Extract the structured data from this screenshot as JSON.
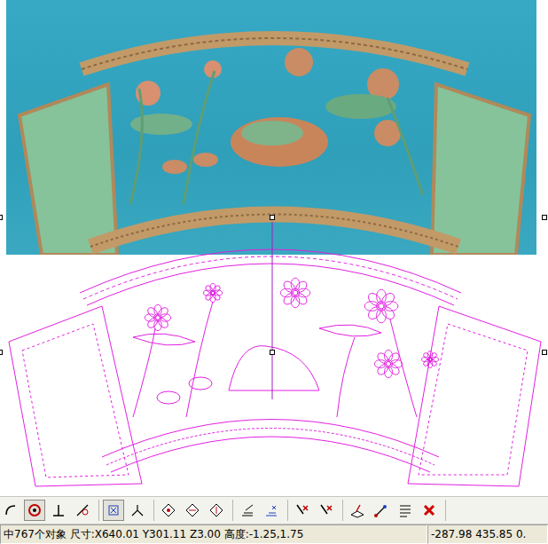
{
  "toolbar": {
    "groups": [
      [
        {
          "selected": false
        },
        {
          "selected": true
        },
        {
          "selected": false
        },
        {
          "selected": false
        }
      ],
      [
        {
          "selected": true
        },
        {
          "selected": false
        }
      ],
      [
        {
          "selected": false
        },
        {
          "selected": false
        },
        {
          "selected": false
        }
      ],
      [
        {
          "selected": false
        },
        {
          "selected": false
        }
      ],
      [
        {
          "selected": false
        },
        {
          "selected": false
        }
      ],
      [
        {
          "selected": false
        },
        {
          "selected": false
        },
        {
          "selected": false
        },
        {
          "selected": false
        }
      ]
    ]
  },
  "status_bar": {
    "selection": "中767个对象 尺寸:X640.01 Y301.11 Z3.00 高度:-1.25,1.75",
    "coordinates": "-287.98 435.85 0."
  }
}
